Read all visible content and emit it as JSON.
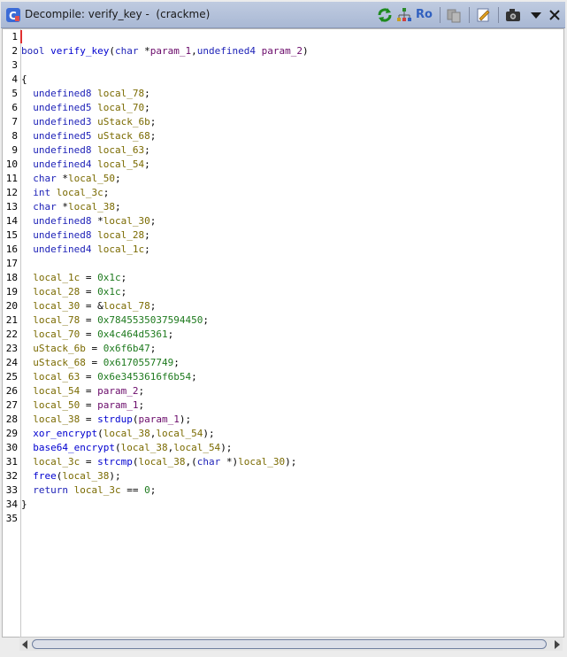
{
  "window": {
    "title": "Decompile: verify_key -  (crackme)"
  },
  "toolbar": {
    "icons": [
      "refresh-icon",
      "graph-icon",
      "read-only-toggle",
      "copy-icon",
      "edit-icon",
      "snapshot-icon",
      "menu-dropdown-icon"
    ],
    "ro_label": "Ro"
  },
  "colors": {
    "type": "#1f23b8",
    "function": "#0000d0",
    "variable": "#7a6a00",
    "parameter": "#6a0a6a",
    "number": "#1e7a1e"
  },
  "code": {
    "lines": [
      [],
      [
        [
          "bool",
          "kw-type"
        ],
        [
          " ",
          "plain"
        ],
        [
          "verify_key",
          "fn"
        ],
        [
          "(",
          "plain"
        ],
        [
          "char",
          "kw-type"
        ],
        [
          " *",
          "plain"
        ],
        [
          "param_1",
          "param"
        ],
        [
          ",",
          "plain"
        ],
        [
          "undefined4",
          "kw-type"
        ],
        [
          " ",
          "plain"
        ],
        [
          "param_2",
          "param"
        ],
        [
          ")",
          "plain"
        ]
      ],
      [],
      [
        [
          "{",
          "plain"
        ]
      ],
      [
        [
          "  ",
          "plain"
        ],
        [
          "undefined8",
          "kw-type"
        ],
        [
          " ",
          "plain"
        ],
        [
          "local_78",
          "var"
        ],
        [
          ";",
          "plain"
        ]
      ],
      [
        [
          "  ",
          "plain"
        ],
        [
          "undefined5",
          "kw-type"
        ],
        [
          " ",
          "plain"
        ],
        [
          "local_70",
          "var"
        ],
        [
          ";",
          "plain"
        ]
      ],
      [
        [
          "  ",
          "plain"
        ],
        [
          "undefined3",
          "kw-type"
        ],
        [
          " ",
          "plain"
        ],
        [
          "uStack_6b",
          "var"
        ],
        [
          ";",
          "plain"
        ]
      ],
      [
        [
          "  ",
          "plain"
        ],
        [
          "undefined5",
          "kw-type"
        ],
        [
          " ",
          "plain"
        ],
        [
          "uStack_68",
          "var"
        ],
        [
          ";",
          "plain"
        ]
      ],
      [
        [
          "  ",
          "plain"
        ],
        [
          "undefined8",
          "kw-type"
        ],
        [
          " ",
          "plain"
        ],
        [
          "local_63",
          "var"
        ],
        [
          ";",
          "plain"
        ]
      ],
      [
        [
          "  ",
          "plain"
        ],
        [
          "undefined4",
          "kw-type"
        ],
        [
          " ",
          "plain"
        ],
        [
          "local_54",
          "var"
        ],
        [
          ";",
          "plain"
        ]
      ],
      [
        [
          "  ",
          "plain"
        ],
        [
          "char",
          "kw-type"
        ],
        [
          " *",
          "plain"
        ],
        [
          "local_50",
          "var"
        ],
        [
          ";",
          "plain"
        ]
      ],
      [
        [
          "  ",
          "plain"
        ],
        [
          "int",
          "kw-type"
        ],
        [
          " ",
          "plain"
        ],
        [
          "local_3c",
          "var"
        ],
        [
          ";",
          "plain"
        ]
      ],
      [
        [
          "  ",
          "plain"
        ],
        [
          "char",
          "kw-type"
        ],
        [
          " *",
          "plain"
        ],
        [
          "local_38",
          "var"
        ],
        [
          ";",
          "plain"
        ]
      ],
      [
        [
          "  ",
          "plain"
        ],
        [
          "undefined8",
          "kw-type"
        ],
        [
          " *",
          "plain"
        ],
        [
          "local_30",
          "var"
        ],
        [
          ";",
          "plain"
        ]
      ],
      [
        [
          "  ",
          "plain"
        ],
        [
          "undefined8",
          "kw-type"
        ],
        [
          " ",
          "plain"
        ],
        [
          "local_28",
          "var"
        ],
        [
          ";",
          "plain"
        ]
      ],
      [
        [
          "  ",
          "plain"
        ],
        [
          "undefined4",
          "kw-type"
        ],
        [
          " ",
          "plain"
        ],
        [
          "local_1c",
          "var"
        ],
        [
          ";",
          "plain"
        ]
      ],
      [],
      [
        [
          "  ",
          "plain"
        ],
        [
          "local_1c",
          "var"
        ],
        [
          " = ",
          "plain"
        ],
        [
          "0x1c",
          "num"
        ],
        [
          ";",
          "plain"
        ]
      ],
      [
        [
          "  ",
          "plain"
        ],
        [
          "local_28",
          "var"
        ],
        [
          " = ",
          "plain"
        ],
        [
          "0x1c",
          "num"
        ],
        [
          ";",
          "plain"
        ]
      ],
      [
        [
          "  ",
          "plain"
        ],
        [
          "local_30",
          "var"
        ],
        [
          " = &",
          "plain"
        ],
        [
          "local_78",
          "var"
        ],
        [
          ";",
          "plain"
        ]
      ],
      [
        [
          "  ",
          "plain"
        ],
        [
          "local_78",
          "var"
        ],
        [
          " = ",
          "plain"
        ],
        [
          "0x7845535037594450",
          "num"
        ],
        [
          ";",
          "plain"
        ]
      ],
      [
        [
          "  ",
          "plain"
        ],
        [
          "local_70",
          "var"
        ],
        [
          " = ",
          "plain"
        ],
        [
          "0x4c464d5361",
          "num"
        ],
        [
          ";",
          "plain"
        ]
      ],
      [
        [
          "  ",
          "plain"
        ],
        [
          "uStack_6b",
          "var"
        ],
        [
          " = ",
          "plain"
        ],
        [
          "0x6f6b47",
          "num"
        ],
        [
          ";",
          "plain"
        ]
      ],
      [
        [
          "  ",
          "plain"
        ],
        [
          "uStack_68",
          "var"
        ],
        [
          " = ",
          "plain"
        ],
        [
          "0x6170557749",
          "num"
        ],
        [
          ";",
          "plain"
        ]
      ],
      [
        [
          "  ",
          "plain"
        ],
        [
          "local_63",
          "var"
        ],
        [
          " = ",
          "plain"
        ],
        [
          "0x6e3453616f6b54",
          "num"
        ],
        [
          ";",
          "plain"
        ]
      ],
      [
        [
          "  ",
          "plain"
        ],
        [
          "local_54",
          "var"
        ],
        [
          " = ",
          "plain"
        ],
        [
          "param_2",
          "param"
        ],
        [
          ";",
          "plain"
        ]
      ],
      [
        [
          "  ",
          "plain"
        ],
        [
          "local_50",
          "var"
        ],
        [
          " = ",
          "plain"
        ],
        [
          "param_1",
          "param"
        ],
        [
          ";",
          "plain"
        ]
      ],
      [
        [
          "  ",
          "plain"
        ],
        [
          "local_38",
          "var"
        ],
        [
          " = ",
          "plain"
        ],
        [
          "strdup",
          "fn"
        ],
        [
          "(",
          "plain"
        ],
        [
          "param_1",
          "param"
        ],
        [
          ");",
          "plain"
        ]
      ],
      [
        [
          "  ",
          "plain"
        ],
        [
          "xor_encrypt",
          "fn"
        ],
        [
          "(",
          "plain"
        ],
        [
          "local_38",
          "var"
        ],
        [
          ",",
          "plain"
        ],
        [
          "local_54",
          "var"
        ],
        [
          ");",
          "plain"
        ]
      ],
      [
        [
          "  ",
          "plain"
        ],
        [
          "base64_encrypt",
          "fn"
        ],
        [
          "(",
          "plain"
        ],
        [
          "local_38",
          "var"
        ],
        [
          ",",
          "plain"
        ],
        [
          "local_54",
          "var"
        ],
        [
          ");",
          "plain"
        ]
      ],
      [
        [
          "  ",
          "plain"
        ],
        [
          "local_3c",
          "var"
        ],
        [
          " = ",
          "plain"
        ],
        [
          "strcmp",
          "fn"
        ],
        [
          "(",
          "plain"
        ],
        [
          "local_38",
          "var"
        ],
        [
          ",(",
          "plain"
        ],
        [
          "char",
          "kw-type"
        ],
        [
          " *)",
          "plain"
        ],
        [
          "local_30",
          "var"
        ],
        [
          ");",
          "plain"
        ]
      ],
      [
        [
          "  ",
          "plain"
        ],
        [
          "free",
          "fn"
        ],
        [
          "(",
          "plain"
        ],
        [
          "local_38",
          "var"
        ],
        [
          ");",
          "plain"
        ]
      ],
      [
        [
          "  ",
          "plain"
        ],
        [
          "return",
          "kw-ctl"
        ],
        [
          " ",
          "plain"
        ],
        [
          "local_3c",
          "var"
        ],
        [
          " == ",
          "plain"
        ],
        [
          "0",
          "num"
        ],
        [
          ";",
          "plain"
        ]
      ],
      [
        [
          "}",
          "plain"
        ]
      ],
      []
    ]
  }
}
